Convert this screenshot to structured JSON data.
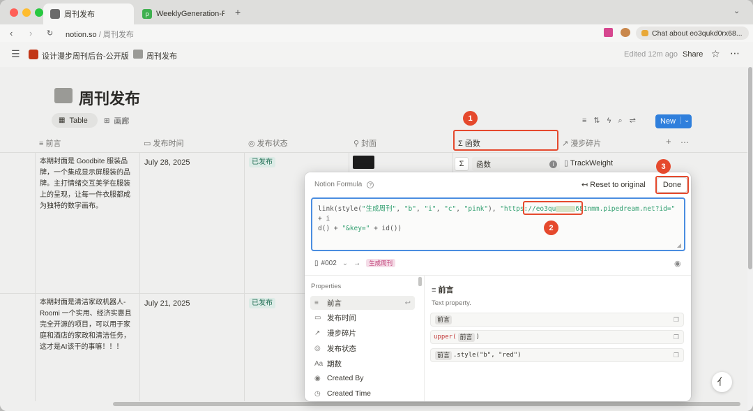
{
  "browser": {
    "tabs": [
      {
        "title": "周刊发布"
      },
      {
        "title": "WeeklyGeneration-Pub"
      }
    ],
    "new_tab_icon": "+",
    "url_domain": "notion.so",
    "url_path": " / 周刊发布",
    "chat_button": "Chat about eo3qukd0rx68..."
  },
  "topbar": {
    "workspace": "设计漫步周刊后台-公开版",
    "page": "周刊发布",
    "edited": "Edited 12m ago",
    "share": "Share"
  },
  "page": {
    "title": "周刊发布",
    "views": [
      {
        "label": "Table"
      },
      {
        "label": "画廊"
      }
    ],
    "new_button": "New"
  },
  "table": {
    "columns": [
      "前言",
      "发布时间",
      "发布状态",
      "封面",
      "函数",
      "漫步碎片"
    ],
    "rows": [
      {
        "preface_lines": [
          "本期封面是 Goodbite 服装品",
          "牌，一个集成显示屏服装的品",
          "牌。主打情绪交互美学在服装",
          "上的呈现，让每一件衣服都成",
          "为独特的数字画布。"
        ],
        "date": "July 28, 2025",
        "status": "已发布"
      },
      {
        "preface_lines": [
          "本期封面是清洁家政机器人-",
          "Roomi 一个实用、经济实惠且",
          "完全开源的项目，可以用于家",
          "庭和酒店的家政和清洁任务，",
          "这才是AI该干的事嘛！！！"
        ],
        "date": "July 21, 2025",
        "status": "已发布"
      }
    ],
    "property_chip": "函数",
    "relation_value": "TrackWeight"
  },
  "formula_popup": {
    "title": "Notion Formula",
    "reset": "Reset to original",
    "done": "Done",
    "code_parts": [
      "link(style(",
      "\"生成周刊\"",
      ", ",
      "\"b\"",
      ", ",
      "\"i\"",
      ", ",
      "\"c\"",
      ", ",
      "\"pink\"",
      "), ",
      "\"https://",
      "eo3qu",
      "681nm",
      "m.pipedream.net?id=\"",
      " + i",
      "d() + ",
      "\"&key=\"",
      " + id())"
    ],
    "preview_id": "#002",
    "preview_tag": "生成周刊",
    "properties_header": "Properties",
    "properties": [
      "前言",
      "发布时间",
      "漫步碎片",
      "发布状态",
      "期数",
      "Created By",
      "Created Time"
    ],
    "detail": {
      "title": "前言",
      "desc": "Text property.",
      "ex1_chip": "前言",
      "ex2_pre": "upper(",
      "ex2_chip": "前言",
      "ex2_post": ")",
      "ex3_chip": "前言",
      "ex3_post": ".style(\"b\", \"red\")"
    }
  },
  "annotations": [
    "1",
    "2",
    "3"
  ],
  "colors": {
    "accent": "#2f7fdc",
    "annotation": "#e5492d",
    "tag_bg": "#dcebe6"
  }
}
